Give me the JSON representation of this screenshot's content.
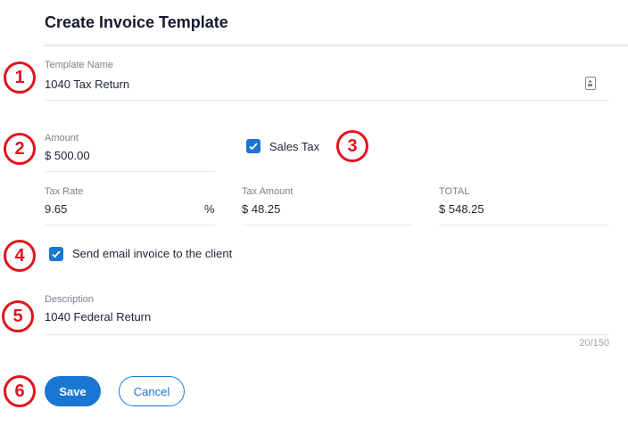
{
  "header": {
    "title": "Create Invoice Template"
  },
  "template_name": {
    "label": "Template Name",
    "value": "1040 Tax Return",
    "icon": "contact-card-icon"
  },
  "amount": {
    "label": "Amount",
    "currency": "$",
    "value": "500.00"
  },
  "sales_tax": {
    "label": "Sales Tax",
    "checked": true
  },
  "tax_rate": {
    "label": "Tax Rate",
    "value": "9.65",
    "suffix": "%"
  },
  "tax_amount": {
    "label": "Tax Amount",
    "currency": "$",
    "value": "48.25"
  },
  "total": {
    "label": "TOTAL",
    "currency": "$",
    "value": "548.25"
  },
  "send_email": {
    "label": "Send email invoice to the client",
    "checked": true
  },
  "description": {
    "label": "Description",
    "value": "1040 Federal Return",
    "counter": "20/150"
  },
  "actions": {
    "save": "Save",
    "cancel": "Cancel"
  },
  "annotations": [
    "1",
    "2",
    "3",
    "4",
    "5",
    "6"
  ],
  "colors": {
    "accent": "#1976d2",
    "annotation": "#e0141e"
  }
}
